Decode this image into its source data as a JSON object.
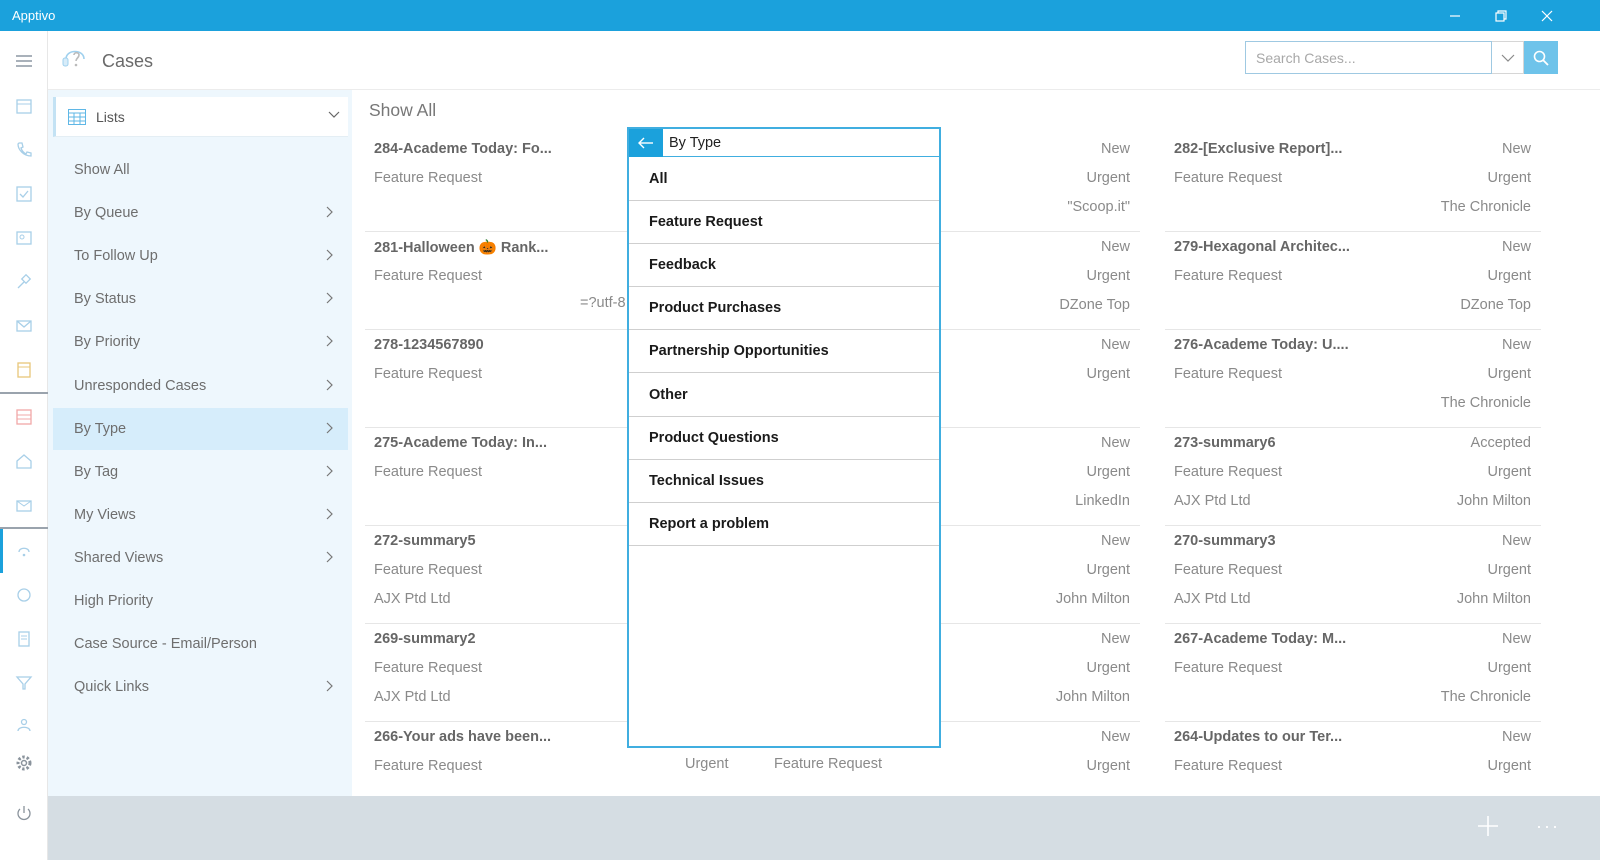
{
  "window": {
    "title": "Apptivo"
  },
  "header": {
    "module_title": "Cases",
    "search_placeholder": "Search Cases..."
  },
  "lists": {
    "label": "Lists",
    "items": [
      {
        "label": "Show All",
        "chevron": false,
        "active": false
      },
      {
        "label": "By Queue",
        "chevron": true,
        "active": false
      },
      {
        "label": "To Follow Up",
        "chevron": true,
        "active": false
      },
      {
        "label": "By Status",
        "chevron": true,
        "active": false
      },
      {
        "label": "By Priority",
        "chevron": true,
        "active": false
      },
      {
        "label": "Unresponded Cases",
        "chevron": true,
        "active": false
      },
      {
        "label": "By Type",
        "chevron": true,
        "active": true
      },
      {
        "label": "By Tag",
        "chevron": true,
        "active": false
      },
      {
        "label": "My Views",
        "chevron": true,
        "active": false
      },
      {
        "label": "Shared Views",
        "chevron": true,
        "active": false
      },
      {
        "label": "High Priority",
        "chevron": false,
        "active": false
      },
      {
        "label": "Case Source - Email/Person",
        "chevron": false,
        "active": false
      },
      {
        "label": "Quick Links",
        "chevron": true,
        "active": false
      }
    ]
  },
  "content": {
    "title": "Show All",
    "left_cards": [
      {
        "title": "284-Academe Today: Fo...",
        "type": "Feature Request",
        "company": "",
        "status": "New",
        "priority": "Urgent",
        "source": "\"Scoop.it\""
      },
      {
        "title": "281-Halloween 🎃 Rank...",
        "type": "Feature Request",
        "company": "",
        "status": "New",
        "priority": "Urgent",
        "source": "DZone Top"
      },
      {
        "title": "278-1234567890",
        "type": "Feature Request",
        "company": "",
        "status": "New",
        "priority": "Urgent",
        "source": ""
      },
      {
        "title": "275-Academe Today: In...",
        "type": "Feature Request",
        "company": "",
        "status": "New",
        "priority": "Urgent",
        "source": "LinkedIn"
      },
      {
        "title": "272-summary5",
        "type": "Feature Request",
        "company": "AJX Ptd Ltd",
        "status": "New",
        "priority": "Urgent",
        "source": "John Milton"
      },
      {
        "title": "269-summary2",
        "type": "Feature Request",
        "company": "AJX Ptd Ltd",
        "status": "New",
        "priority": "Urgent",
        "source": "John Milton"
      },
      {
        "title": "266-Your ads have been...",
        "type": "Feature Request",
        "company": "",
        "status": "New",
        "priority": "Urgent",
        "source": ""
      }
    ],
    "right_cards": [
      {
        "title": "282-[Exclusive Report]...",
        "type": "Feature Request",
        "company": "",
        "status": "New",
        "priority": "Urgent",
        "source": "The Chronicle"
      },
      {
        "title": "279-Hexagonal Architec...",
        "type": "Feature Request",
        "company": "",
        "status": "New",
        "priority": "Urgent",
        "source": "DZone Top"
      },
      {
        "title": "276-Academe Today: U....",
        "type": "Feature Request",
        "company": "",
        "status": "New",
        "priority": "Urgent",
        "source": "The Chronicle"
      },
      {
        "title": "273-summary6",
        "type": "Feature Request",
        "company": "AJX Ptd Ltd",
        "status": "Accepted",
        "priority": "Urgent",
        "source": "John Milton"
      },
      {
        "title": "270-summary3",
        "type": "Feature Request",
        "company": "AJX Ptd Ltd",
        "status": "New",
        "priority": "Urgent",
        "source": "John Milton"
      },
      {
        "title": "267-Academe Today: M...",
        "type": "Feature Request",
        "company": "",
        "status": "New",
        "priority": "Urgent",
        "source": "The Chronicle"
      },
      {
        "title": "264-Updates to our Ter...",
        "type": "Feature Request",
        "company": "",
        "status": "New",
        "priority": "Urgent",
        "source": ""
      }
    ],
    "fragments": {
      "utf": "=?utf-8",
      "mid_urgent": "Urgent",
      "mid_type": "Feature Request"
    }
  },
  "popup": {
    "title": "By Type",
    "options": [
      "All",
      "Feature Request",
      "Feedback",
      "Product Purchases",
      "Partnership Opportunities",
      "Other",
      "Product Questions",
      "Technical Issues",
      "Report a problem"
    ]
  },
  "bottombar": {
    "more_label": "···"
  },
  "colors": {
    "accent": "#1ba1dc",
    "nav_bg": "#eef7fd",
    "nav_active": "#d6edfb",
    "bottom_bar": "#d5dde3"
  }
}
